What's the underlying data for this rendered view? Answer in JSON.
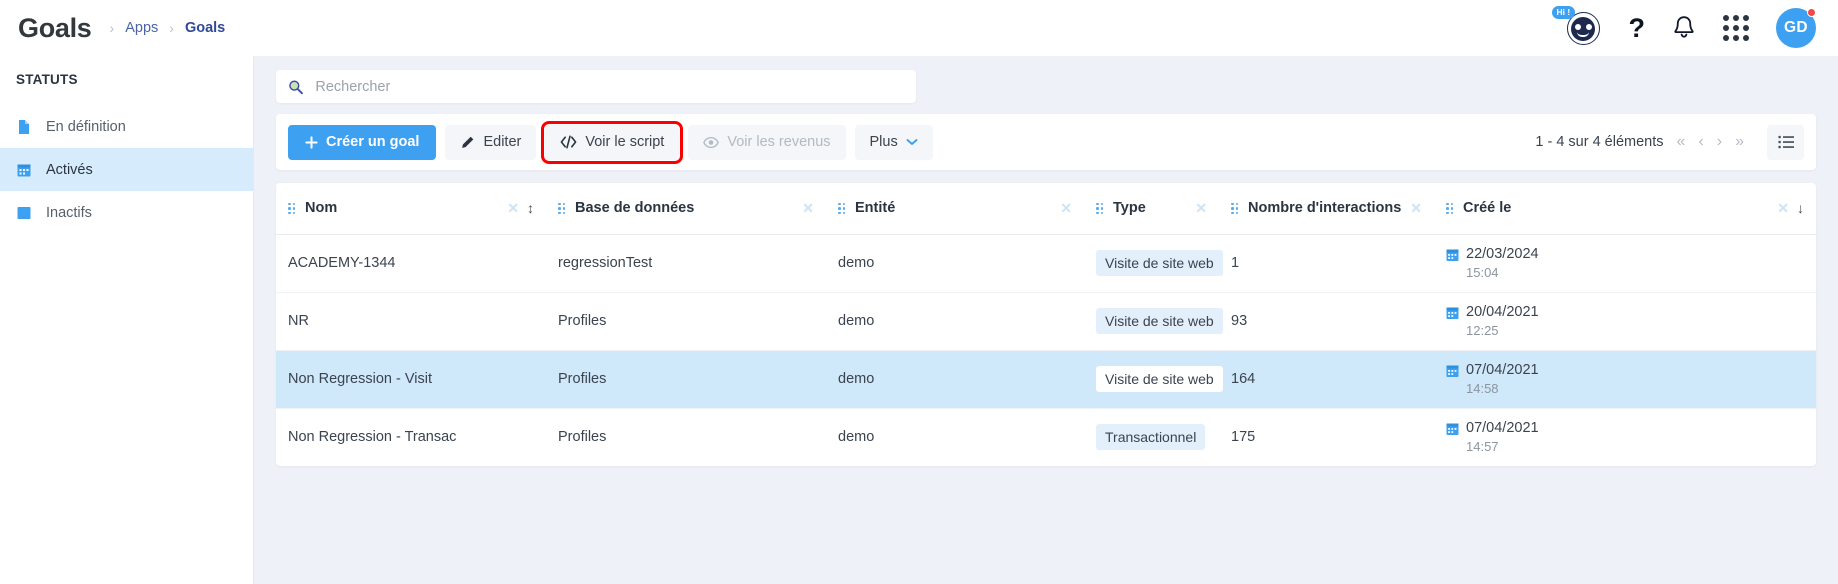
{
  "header": {
    "app_title": "Goals",
    "breadcrumb": [
      {
        "label": "Apps",
        "current": false
      },
      {
        "label": "Goals",
        "current": true
      }
    ],
    "separator": "›",
    "bot_badge": "Hi !",
    "help_glyph": "?",
    "avatar_initials": "GD",
    "accent_color": "#3da0f0",
    "notification_dot_color": "#f8453f"
  },
  "sidebar": {
    "title": "STATUTS",
    "items": [
      {
        "label": "En définition",
        "icon": "document-icon",
        "active": false
      },
      {
        "label": "Activés",
        "icon": "calendar-icon",
        "active": true
      },
      {
        "label": "Inactifs",
        "icon": "square-icon",
        "active": false
      }
    ]
  },
  "search": {
    "placeholder": "Rechercher",
    "value": "",
    "icon": "search-icon"
  },
  "toolbar": {
    "create_label": "Créer un goal",
    "create_icon": "plus-icon",
    "edit_label": "Editer",
    "edit_icon": "pencil-icon",
    "script_label": "Voir le script",
    "script_icon": "code-icon",
    "revenue_label": "Voir les revenus",
    "revenue_icon": "eye-icon",
    "more_label": "Plus",
    "more_icon": "chevron-down-icon",
    "highlight_color": "#fb0000"
  },
  "pagination": {
    "summary": "1 - 4 sur 4 éléments",
    "first_icon": "«",
    "prev_icon": "‹",
    "next_icon": "›",
    "last_icon": "»",
    "view_toggle_icon": "list-view-icon"
  },
  "table": {
    "columns": [
      {
        "label": "Nom",
        "removable": true,
        "sort": "↕"
      },
      {
        "label": "Base de données",
        "removable": true,
        "sort": ""
      },
      {
        "label": "Entité",
        "removable": true,
        "sort": ""
      },
      {
        "label": "Type",
        "removable": true,
        "sort": ""
      },
      {
        "label": "Nombre d'interactions",
        "removable": true,
        "sort": ""
      },
      {
        "label": "Créé le",
        "removable": true,
        "sort": "↓"
      }
    ],
    "rows": [
      {
        "nom": "ACADEMY-1344",
        "base": "regressionTest",
        "entite": "demo",
        "type": "Visite de site web",
        "interactions": "1",
        "date": "22/03/2024",
        "time": "15:04",
        "selected": false
      },
      {
        "nom": "NR",
        "base": "Profiles",
        "entite": "demo",
        "type": "Visite de site web",
        "interactions": "93",
        "date": "20/04/2021",
        "time": "12:25",
        "selected": false
      },
      {
        "nom": "Non Regression - Visit",
        "base": "Profiles",
        "entite": "demo",
        "type": "Visite de site web",
        "interactions": "164",
        "date": "07/04/2021",
        "time": "14:58",
        "selected": true
      },
      {
        "nom": "Non Regression - Transac",
        "base": "Profiles",
        "entite": "demo",
        "type": "Transactionnel",
        "interactions": "175",
        "date": "07/04/2021",
        "time": "14:57",
        "selected": false
      }
    ]
  }
}
